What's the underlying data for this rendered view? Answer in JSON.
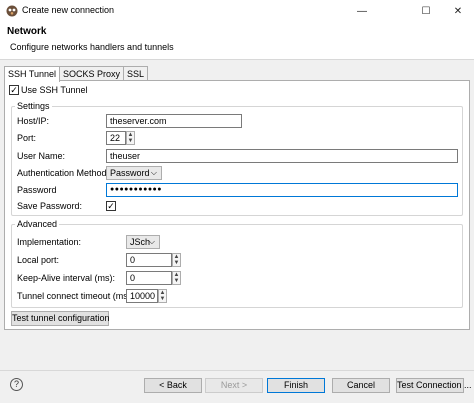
{
  "window": {
    "title": "Create new connection",
    "minimize_glyph": "—",
    "maximize_glyph": "☐",
    "close_glyph": "✕"
  },
  "header": {
    "title": "Network",
    "description": "Configure networks handlers and tunnels"
  },
  "tabs": [
    {
      "label": "SSH Tunnel",
      "active": true
    },
    {
      "label": "SOCKS Proxy",
      "active": false
    },
    {
      "label": "SSL",
      "active": false
    }
  ],
  "use_ssh_tunnel": {
    "label": "Use SSH Tunnel",
    "checked_glyph": "✓"
  },
  "settings": {
    "group_label": "Settings",
    "host_label": "Host/IP:",
    "host_value": "theserver.com",
    "port_label": "Port:",
    "port_value": "22",
    "user_label": "User Name:",
    "user_value": "theuser",
    "auth_label": "Authentication Method:",
    "auth_value": "Password",
    "password_label": "Password",
    "password_value": "●●●●●●●●●●●",
    "save_password_label": "Save Password:",
    "save_password_glyph": "✓"
  },
  "advanced": {
    "group_label": "Advanced",
    "implementation_label": "Implementation:",
    "implementation_value": "JSch",
    "local_port_label": "Local port:",
    "local_port_value": "0",
    "keepalive_label": "Keep-Alive interval (ms):",
    "keepalive_value": "0",
    "timeout_label": "Tunnel connect timeout (ms):",
    "timeout_value": "10000"
  },
  "test_tunnel_label": "Test tunnel configuration",
  "footer": {
    "help_glyph": "?",
    "back_label": "< Back",
    "next_label": "Next >",
    "finish_label": "Finish",
    "cancel_label": "Cancel",
    "test_connection_label": "Test Connection ..."
  },
  "glyphs": {
    "chevron_down": "⌵",
    "spin_up": "▲",
    "spin_down": "▼"
  }
}
